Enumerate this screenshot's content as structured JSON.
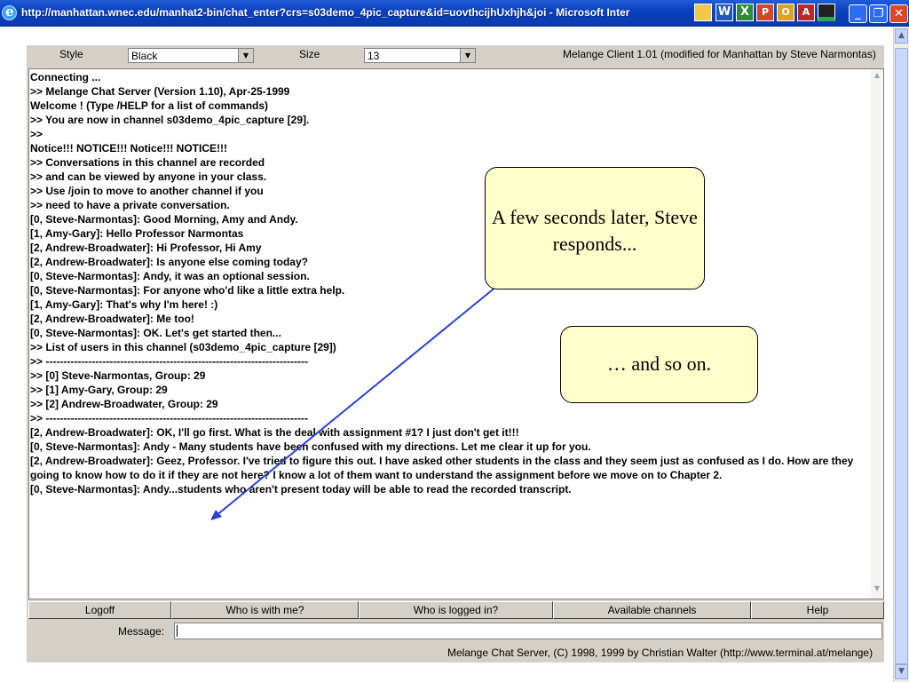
{
  "window": {
    "title": "http://manhattan.wnec.edu/manhat2-bin/chat_enter?crs=s03demo_4pic_capture&id=uovthcijhUxhjh&joi - Microsoft Inter",
    "tray_icons": [
      "word-icon",
      "excel-icon",
      "powerpoint-icon",
      "outlook-icon",
      "access-icon",
      "monitor-icon"
    ],
    "controls": {
      "minimize": "_",
      "maximize": "❐",
      "close": "✕"
    }
  },
  "toolbar": {
    "style_label": "Style",
    "style_value": "Black",
    "size_label": "Size",
    "size_value": "13",
    "client_info": "Melange Client 1.01 (modified for Manhattan by Steve Narmontas)"
  },
  "chat": {
    "lines": [
      "Connecting ...",
      ">> Melange Chat Server (Version 1.10), Apr-25-1999",
      "Welcome ! (Type /HELP for a list of commands)",
      ">> You are now in channel s03demo_4pic_capture [29].",
      ">>",
      "Notice!!! NOTICE!!! Notice!!! NOTICE!!!",
      ">> Conversations in this channel are recorded",
      ">> and can be viewed by anyone in your class.",
      ">> Use /join to move to another channel if you",
      ">> need to have a private conversation.",
      "[0, Steve-Narmontas]: Good Morning, Amy and Andy.",
      "[1, Amy-Gary]: Hello Professor Narmontas",
      "[2, Andrew-Broadwater]: Hi Professor, Hi Amy",
      "[2, Andrew-Broadwater]: Is anyone else coming today?",
      "[0, Steve-Narmontas]: Andy, it was an optional session.",
      "[0, Steve-Narmontas]: For anyone who'd like a little extra help.",
      "[1, Amy-Gary]: That's why I'm here! :)",
      "[2, Andrew-Broadwater]: Me too!",
      "[0, Steve-Narmontas]: OK. Let's get started then...",
      ">> List of users in this channel (s03demo_4pic_capture [29])",
      ">> --------------------------------------------------------------------------",
      ">> [0] Steve-Narmontas, Group: 29",
      ">> [1] Amy-Gary, Group: 29",
      ">> [2] Andrew-Broadwater, Group: 29",
      ">> --------------------------------------------------------------------------",
      "[2, Andrew-Broadwater]: OK, I'll go first. What is the deal with assignment #1? I just don't get it!!!",
      "[0, Steve-Narmontas]: Andy - Many students have been confused with my directions. Let me clear it up for you.",
      "[2, Andrew-Broadwater]: Geez, Professor. I've tried to figure this out. I have asked other students in the class and they seem just as confused as I do. How are they going to know how to do it if they are not here? I know a lot of them want to understand the assignment before we move on to Chapter 2.",
      "[0, Steve-Narmontas]: Andy...students who aren't present today will be able to read the recorded transcript."
    ]
  },
  "buttons": {
    "logoff": "Logoff",
    "who_with": "Who is with me?",
    "who_logged": "Who is logged in?",
    "channels": "Available channels",
    "help": "Help"
  },
  "message": {
    "label": "Message:",
    "value": ""
  },
  "footer": {
    "copyright": "Melange Chat Server, (C) 1998, 1999 by Christian Walter  (http://www.terminal.at/melange)"
  },
  "callouts": {
    "first": "A few seconds later, Steve responds...",
    "second": "… and so on."
  },
  "colors": {
    "arrow": "#2a3fd6",
    "callout_fill": "#ffffcc",
    "titlebar": "#0a3fbf"
  }
}
